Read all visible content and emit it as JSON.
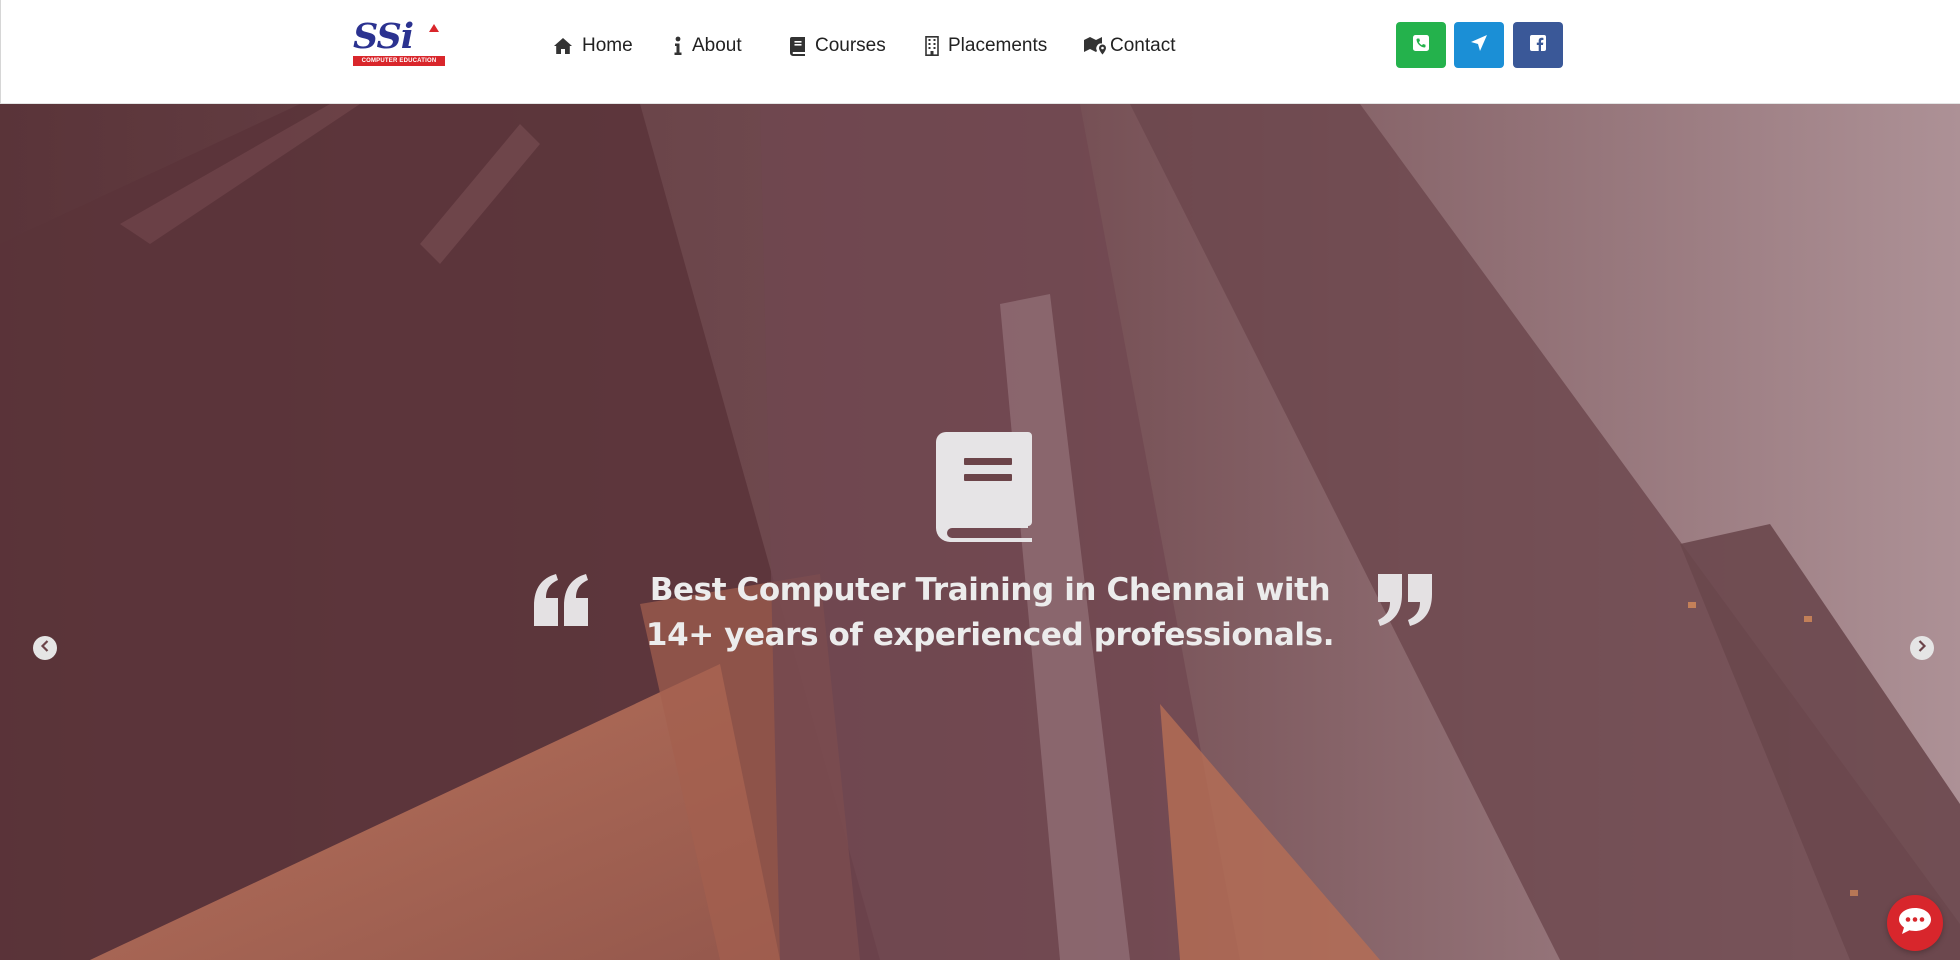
{
  "logo": {
    "text": "SSi",
    "subtext": "COMPUTER EDUCATION"
  },
  "nav": {
    "items": [
      {
        "label": "Home",
        "icon": "home-icon"
      },
      {
        "label": "About",
        "icon": "info-icon"
      },
      {
        "label": "Courses",
        "icon": "book-icon"
      },
      {
        "label": "Placements",
        "icon": "building-icon"
      },
      {
        "label": "Contact",
        "icon": "map-icon"
      }
    ]
  },
  "social": [
    {
      "icon": "phone-icon",
      "color": "#24b24c"
    },
    {
      "icon": "location-arrow-icon",
      "color": "#1b8fd6"
    },
    {
      "icon": "facebook-icon",
      "color": "#3a5898"
    }
  ],
  "hero": {
    "icon": "book-icon",
    "tagline": "Best Computer Training in Chennai with 14+ years of experienced professionals."
  },
  "colors": {
    "brand_blue": "#2b3290",
    "brand_red": "#d9262b",
    "chat_button": "#d8262c"
  }
}
